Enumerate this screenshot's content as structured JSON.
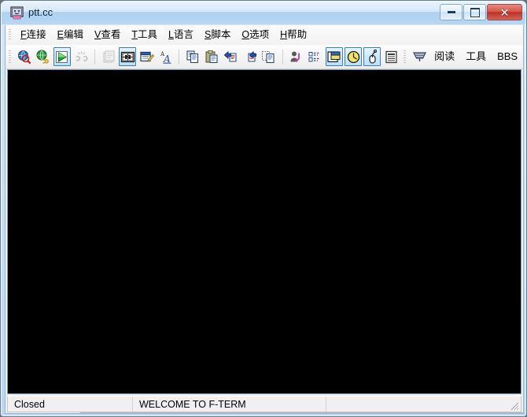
{
  "window": {
    "title": "ptt.cc",
    "icon": "terminal-monitor-icon",
    "controls": {
      "minimize": "minimize-button",
      "maximize": "maximize-button",
      "close": "close-button"
    }
  },
  "menu": {
    "items": [
      {
        "name": "connect",
        "mnemonic": "F",
        "label": "连接"
      },
      {
        "name": "edit",
        "mnemonic": "E",
        "label": "编辑"
      },
      {
        "name": "view",
        "mnemonic": "V",
        "label": "查看"
      },
      {
        "name": "tools",
        "mnemonic": "T",
        "label": "工具"
      },
      {
        "name": "language",
        "mnemonic": "L",
        "label": "语言"
      },
      {
        "name": "script",
        "mnemonic": "S",
        "label": "脚本"
      },
      {
        "name": "options",
        "mnemonic": "O",
        "label": "选项"
      },
      {
        "name": "help",
        "mnemonic": "H",
        "label": "帮助"
      }
    ]
  },
  "toolbar": {
    "buttons": [
      {
        "name": "site-search-icon",
        "state": "normal"
      },
      {
        "name": "site-link-icon",
        "state": "normal"
      },
      {
        "name": "connect-play-icon",
        "state": "checked"
      },
      {
        "name": "disconnect-icon",
        "state": "disabled"
      },
      {
        "name": "open-window-icon",
        "state": "disabled"
      },
      {
        "name": "address-book-icon",
        "state": "checked"
      },
      {
        "name": "schedule-edit-icon",
        "state": "normal"
      },
      {
        "name": "font-icon",
        "state": "normal"
      },
      {
        "name": "copy-icon",
        "state": "normal"
      },
      {
        "name": "paste-icon",
        "state": "normal"
      },
      {
        "name": "prev-article-icon",
        "state": "normal"
      },
      {
        "name": "next-article-icon",
        "state": "normal"
      },
      {
        "name": "select-copy-icon",
        "state": "normal"
      },
      {
        "name": "anti-idle-icon",
        "state": "normal"
      },
      {
        "name": "list-icon",
        "state": "normal"
      },
      {
        "name": "screen-window-icon",
        "state": "checked"
      },
      {
        "name": "timer-clock-icon",
        "state": "checked"
      },
      {
        "name": "mouse-support-icon",
        "state": "checked"
      },
      {
        "name": "article-list-icon",
        "state": "normal"
      },
      {
        "name": "keyboard-macro-icon",
        "state": "normal"
      }
    ],
    "text_buttons": [
      {
        "name": "read-button",
        "label": "阅读"
      },
      {
        "name": "tools-button",
        "label": "工具"
      },
      {
        "name": "bbs-button",
        "label": "BBS"
      }
    ]
  },
  "terminal": {
    "content": "",
    "background": "#000000"
  },
  "tabs": [
    {
      "name": "tab-ptt-cc",
      "label": "ptt.cc",
      "icon": "monitor-icon",
      "active": true
    }
  ],
  "status": {
    "connection": "Closed",
    "message": "WELCOME TO F-TERM",
    "extra": ""
  },
  "colors": {
    "titlebar_accent": "#aed2f0",
    "close_button": "#bb2f22",
    "toolbar_checked_border": "#3c7fb1",
    "terminal_bg": "#000000",
    "frame": "#5f7d98"
  }
}
